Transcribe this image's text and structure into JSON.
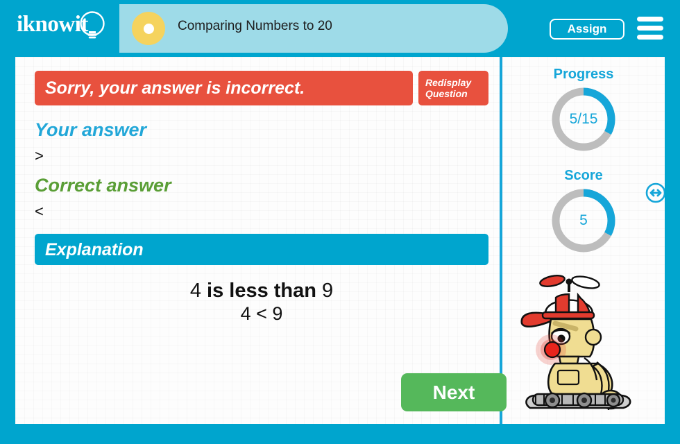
{
  "header": {
    "logo_text": "iknowit",
    "logo_icon": "lightbulb-icon",
    "lesson_title": "Comparing Numbers to 20",
    "assign_label": "Assign",
    "menu_icon": "hamburger-menu-icon"
  },
  "result": {
    "banner_text": "Sorry, your answer is incorrect.",
    "redisplay_label": "Redisplay\nQuestion",
    "your_answer_heading": "Your answer",
    "your_answer_value": ">",
    "correct_answer_heading": "Correct answer",
    "correct_answer_value": "<"
  },
  "explanation": {
    "heading": "Explanation",
    "line1_prefix": "4",
    "line1_bold": "is less than",
    "line1_suffix": "9",
    "line2": "4 < 9"
  },
  "actions": {
    "next_label": "Next"
  },
  "stats": {
    "progress_label": "Progress",
    "progress_value": "5/15",
    "progress_current": 5,
    "progress_total": 15,
    "progress_percent": 33,
    "score_label": "Score",
    "score_value": "5",
    "score_percent": 33
  },
  "mascot": {
    "name": "robot-mascot",
    "expand_icon": "horizontal-resize-icon"
  },
  "colors": {
    "brand_blue": "#00a5ce",
    "accent_blue": "#16a6d9",
    "title_pill": "#9edbe8",
    "title_dot": "#f5d35e",
    "incorrect_red": "#e8513e",
    "correct_green": "#5a9e36",
    "next_green": "#55b85b",
    "gauge_track": "#bdbdbd"
  }
}
